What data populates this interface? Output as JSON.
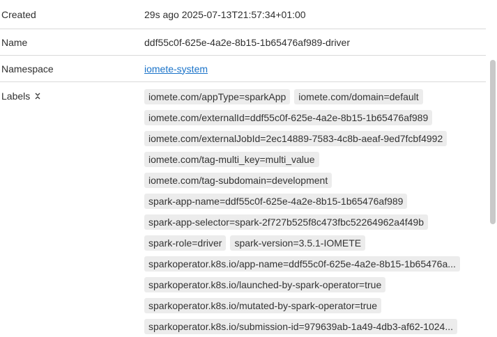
{
  "details": {
    "created": {
      "label": "Created",
      "value": "29s ago 2025-07-13T21:57:34+01:00"
    },
    "name": {
      "label": "Name",
      "value": "ddf55c0f-625e-4a2e-8b15-1b65476af989-driver"
    },
    "namespace": {
      "label": "Namespace",
      "value": "iomete-system"
    },
    "labels": {
      "label": "Labels",
      "items": [
        "iomete.com/appType=sparkApp",
        "iomete.com/domain=default",
        "iomete.com/externalId=ddf55c0f-625e-4a2e-8b15-1b65476af989",
        "iomete.com/externalJobId=2ec14889-7583-4c8b-aeaf-9ed7fcbf4992",
        "iomete.com/tag-multi_key=multi_value",
        "iomete.com/tag-subdomain=development",
        "spark-app-name=ddf55c0f-625e-4a2e-8b15-1b65476af989",
        "spark-app-selector=spark-2f727b525f8c473fbc52264962a4f49b",
        "spark-role=driver",
        "spark-version=3.5.1-IOMETE",
        "sparkoperator.k8s.io/app-name=ddf55c0f-625e-4a2e-8b15-1b65476a...",
        "sparkoperator.k8s.io/launched-by-spark-operator=true",
        "sparkoperator.k8s.io/mutated-by-spark-operator=true",
        "sparkoperator.k8s.io/submission-id=979639ab-1a49-4db3-af62-1024..."
      ]
    }
  },
  "icons": {
    "sort": "sort-icon"
  }
}
